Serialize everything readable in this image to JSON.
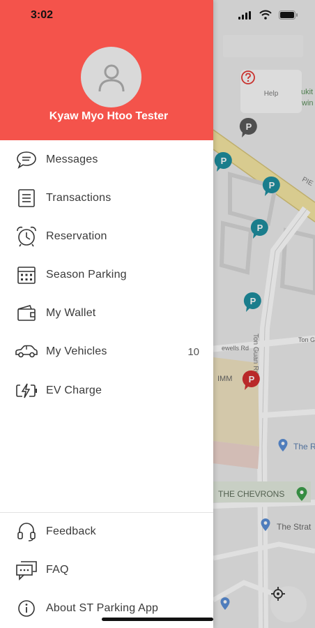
{
  "status_bar": {
    "time": "3:02"
  },
  "profile": {
    "name": "Kyaw Myo Htoo Tester"
  },
  "menu": {
    "main_items": [
      {
        "label": "Messages",
        "icon": "chat-bubble-icon"
      },
      {
        "label": "Transactions",
        "icon": "list-document-icon"
      },
      {
        "label": "Reservation",
        "icon": "alarm-clock-icon"
      },
      {
        "label": "Season Parking",
        "icon": "calendar-icon"
      },
      {
        "label": "My Wallet",
        "icon": "wallet-icon"
      },
      {
        "label": "My Vehicles",
        "icon": "car-icon",
        "count": "10"
      },
      {
        "label": "EV Charge",
        "icon": "ev-charge-icon"
      }
    ],
    "footer_items": [
      {
        "label": "Feedback",
        "icon": "headset-icon"
      },
      {
        "label": "FAQ",
        "icon": "faq-chat-icon"
      },
      {
        "label": "About ST Parking App",
        "icon": "info-icon"
      }
    ]
  },
  "map": {
    "help_label": "Help",
    "road_pie": "PIE",
    "road_ton_guan": "Ton Guan Rd",
    "place_chevrons": "THE CHEVRONS",
    "place_the_r": "The R",
    "place_the_strat": "The Strat",
    "place_bukit": "ukit",
    "place_win": "win",
    "place_imm": "IMM",
    "road_small_1": "ewells Rd",
    "road_small_2": "Ton G"
  },
  "colors": {
    "brand": "#f4534b",
    "parking_teal": "#1e8fa0",
    "parking_red": "#d32f2f"
  }
}
